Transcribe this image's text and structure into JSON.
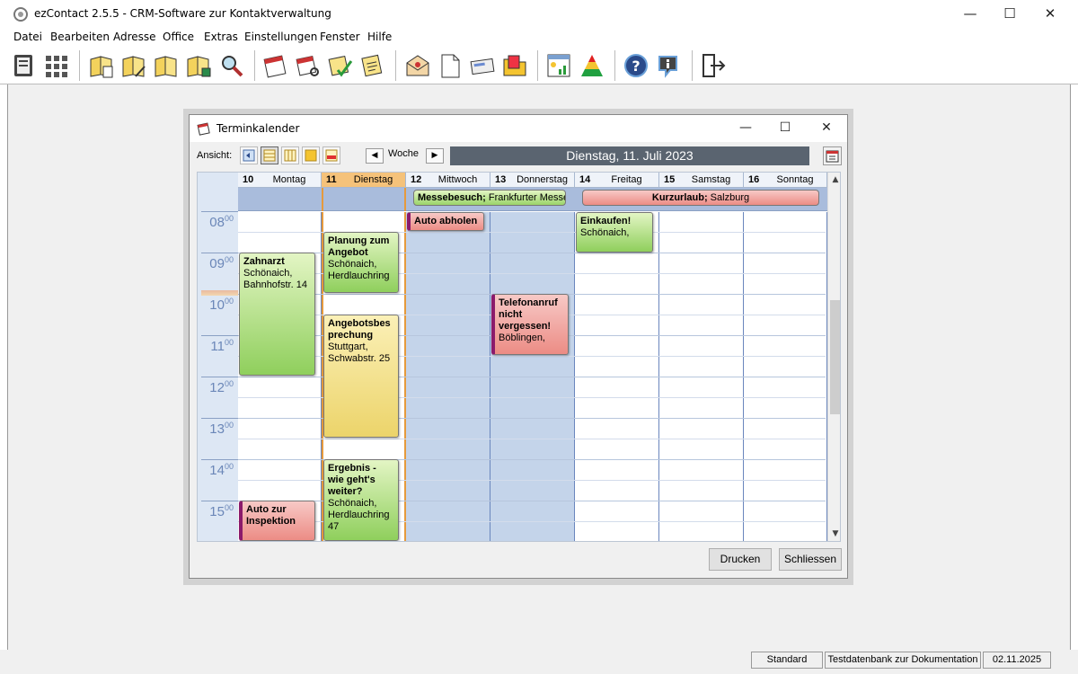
{
  "app": {
    "title": "ezContact 2.5.5  -  CRM-Software zur Kontaktverwaltung",
    "minimize": "—",
    "maximize": "☐",
    "close": "✕"
  },
  "menu": [
    "Datei",
    "Bearbeiten",
    "Adresse",
    "Office",
    "Extras",
    "Einstellungen",
    "Fenster",
    "Hilfe"
  ],
  "toolbar_icons": [
    "contacts-book-icon",
    "grid-icon",
    "address-new-icon",
    "address-edit-icon",
    "address-open-icon",
    "address-lock-icon",
    "address-search-icon",
    "calendar-icon",
    "calendar-search-icon",
    "calendar-check-icon",
    "notes-icon",
    "mail-icon",
    "document-icon",
    "envelope-icon",
    "folder-icon",
    "report-icon",
    "chart-triangle-icon",
    "help-icon",
    "info-icon",
    "exit-icon"
  ],
  "dialog": {
    "title": "Terminkalender",
    "minimize": "—",
    "maximize": "☐",
    "close": "✕",
    "view_label": "Ansicht:",
    "nav_prev": "◀",
    "nav_next": "▶",
    "period_label": "Woche",
    "date_banner": "Dienstag, 11. Juli 2023",
    "print_button": "Drucken",
    "close_button": "Schliessen"
  },
  "days": [
    {
      "num": "10",
      "name": "Montag"
    },
    {
      "num": "11",
      "name": "Dienstag"
    },
    {
      "num": "12",
      "name": "Mittwoch"
    },
    {
      "num": "13",
      "name": "Donnerstag"
    },
    {
      "num": "14",
      "name": "Freitag"
    },
    {
      "num": "15",
      "name": "Samstag"
    },
    {
      "num": "16",
      "name": "Sonntag"
    }
  ],
  "hours": [
    "08",
    "09",
    "10",
    "11",
    "12",
    "13",
    "14",
    "15"
  ],
  "minutes": "00",
  "allday_events": [
    {
      "title": "Messebesuch;",
      "place": " Frankfurter Messe"
    },
    {
      "title": "Kurzurlaub;",
      "place": " Salzburg"
    }
  ],
  "appointments": {
    "zahnarzt": {
      "title": "Zahnarzt",
      "line1": "Schönaich,",
      "line2": "Bahnhofstr. 14"
    },
    "auto_inspektion": {
      "title": "Auto zur Inspektion"
    },
    "planung": {
      "title": "Planung zum Angebot",
      "line1": "Schönaich,",
      "line2": "Herdlauchring"
    },
    "angebot": {
      "title": "Angebotsbes prechung",
      "line1": "Stuttgart,",
      "line2": "Schwabstr. 25"
    },
    "ergebnis": {
      "title": "Ergebnis - wie geht's weiter?",
      "line1": "Schönaich,",
      "line2": "Herdlauchring 47"
    },
    "auto_abholen": {
      "title": "Auto abholen"
    },
    "telefonanruf": {
      "title": "Telefonanruf nicht vergessen!",
      "line1": "Böblingen,"
    },
    "einkaufen": {
      "title": "Einkaufen!",
      "line1": "Schönaich,"
    }
  },
  "status": {
    "mode": "Standard",
    "database": "Testdatenbank zur Dokumentation",
    "date": "02.11.2025"
  },
  "colors": {
    "today_header": "#f5c27a",
    "busy_day": "#c4d4ea",
    "date_banner": "#5a6470"
  }
}
